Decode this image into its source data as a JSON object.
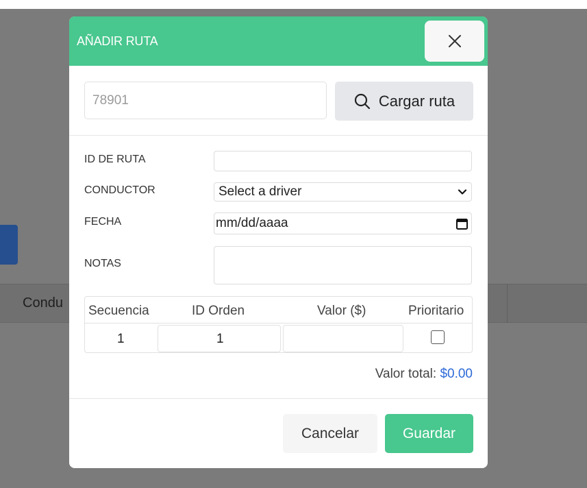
{
  "background": {
    "partial_button_glyph": "/",
    "table_column_label": "Condu"
  },
  "modal": {
    "title": "AÑADIR RUTA",
    "close_icon": "close-icon",
    "search": {
      "placeholder": "78901",
      "button_label": "Cargar ruta",
      "button_icon": "search-icon"
    },
    "form": {
      "route_id_label": "ID DE RUTA",
      "route_id_value": "",
      "driver_label": "CONDUCTOR",
      "driver_selected": "Select a driver",
      "date_label": "FECHA",
      "date_value": "mm/dd/aaaa",
      "notes_label": "NOTAS",
      "notes_value": ""
    },
    "table": {
      "headers": [
        "Secuencia",
        "ID Orden",
        "Valor ($)",
        "Prioritario"
      ],
      "rows": [
        {
          "sequence": "1",
          "order_id": "1",
          "value": "",
          "priority": false
        }
      ]
    },
    "total": {
      "label": "Valor total:",
      "value": "$0.00"
    },
    "footer": {
      "cancel_label": "Cancelar",
      "save_label": "Guardar"
    }
  },
  "colors": {
    "header_green": "#48c78e",
    "accent_blue": "#2d6ad8",
    "overlay_gray": "#7b7b7b"
  }
}
